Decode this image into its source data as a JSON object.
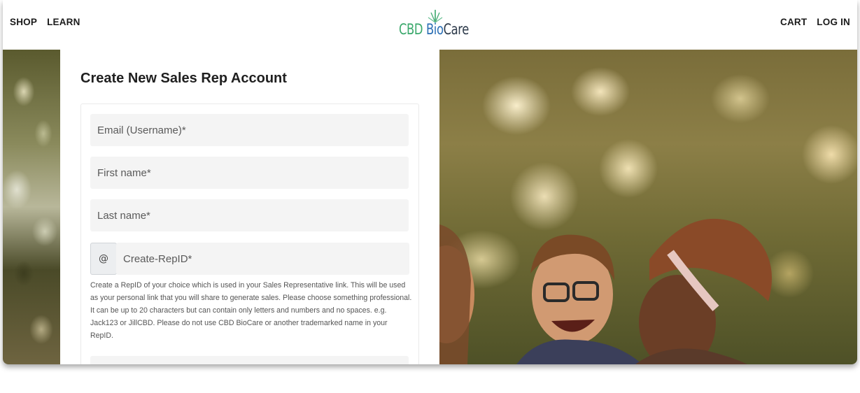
{
  "header": {
    "nav_left": [
      "SHOP",
      "LEARN"
    ],
    "nav_right": [
      "CART",
      "LOG IN"
    ],
    "logo": {
      "cbd": "CBD ",
      "bio": "Bio",
      "care": "Care"
    }
  },
  "form": {
    "title": "Create New Sales Rep Account",
    "email_placeholder": "Email (Username)*",
    "first_name_placeholder": "First name*",
    "last_name_placeholder": "Last name*",
    "rep_prefix": "@",
    "rep_placeholder": "Create-RepID*",
    "rep_help": "Create a RepID of your choice which is used in your Sales Representative link. This will be used as your personal link that you will share to generate sales. Please choose something professional. It can be up to 20 characters but can contain only letters and numbers and no spaces. e.g. Jack123 or JillCBD. Please do not use CBD BioCare or another trademarked name in your RepID."
  },
  "colors": {
    "logo_green": "#3aa86b",
    "logo_blue": "#2b6fb5",
    "logo_dark": "#2d3a4a"
  }
}
